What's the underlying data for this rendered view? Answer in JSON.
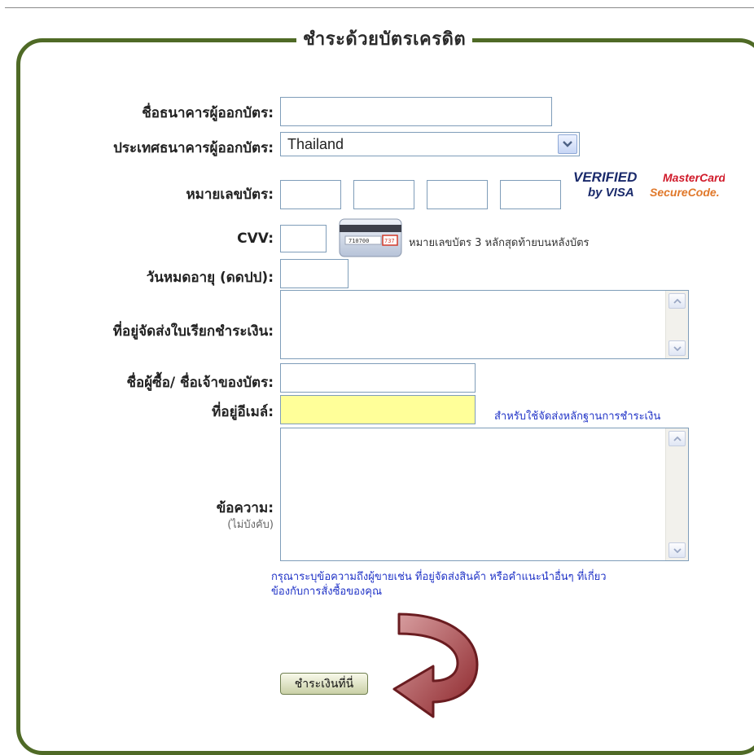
{
  "form": {
    "title": "ชำระด้วยบัตรเครดิต",
    "fields": {
      "bank_name": {
        "label": "ชื่อธนาคารผู้ออกบัตร:",
        "value": ""
      },
      "bank_country": {
        "label": "ประเทศธนาคารผู้ออกบัตร:",
        "value": "Thailand"
      },
      "card_number": {
        "label": "หมายเลขบัตร:",
        "values": [
          "",
          "",
          "",
          ""
        ]
      },
      "cvv": {
        "label": "CVV:",
        "value": "",
        "hint": "หมายเลขบัตร 3 หลักสุดท้ายบนหลังบัตร"
      },
      "expiry": {
        "label": "วันหมดอายุ (ดดปป):",
        "value": ""
      },
      "billing_address": {
        "label": "ที่อยู่จัดส่งใบเรียกชำระเงิน:",
        "value": ""
      },
      "card_holder": {
        "label": "ชื่อผู้ซื้อ/ ชื่อเจ้าของบัตร:",
        "value": ""
      },
      "email": {
        "label": "ที่อยู่อีเมล์:",
        "value": "",
        "note": "สำหรับใช้จัดส่งหลักฐานการชำระเงิน"
      },
      "message": {
        "label": "ข้อความ:",
        "sublabel": "(ไม่บังคับ)",
        "value": "",
        "note_line1": "กรุณาระบุข้อความถึงผู้ขายเช่น ที่อยู่จัดส่งสินค้า หรือคำแนะนำอื่นๆ ที่เกี่ยว",
        "note_line2": "ข้องกับการสั่งซื้อของคุณ"
      }
    },
    "secure_logos": {
      "verified_line1": "VERIFIED",
      "verified_line2": "by VISA",
      "mastercard_line1": "MasterCard.",
      "mastercard_line2": "SecureCode."
    },
    "card_image_numbers": {
      "left": "710700",
      "right": "737"
    },
    "submit_label": "ชำระเงินที่นี่"
  },
  "colors": {
    "frame": "#4f6a26",
    "email_highlight": "#ffff99",
    "note_text": "#2033c7",
    "arrow": "#b03a3e"
  },
  "icons": [
    "dropdown-arrow-icon",
    "scroll-up-icon",
    "scroll-down-icon",
    "cvv-card-icon",
    "curved-arrow-icon"
  ]
}
